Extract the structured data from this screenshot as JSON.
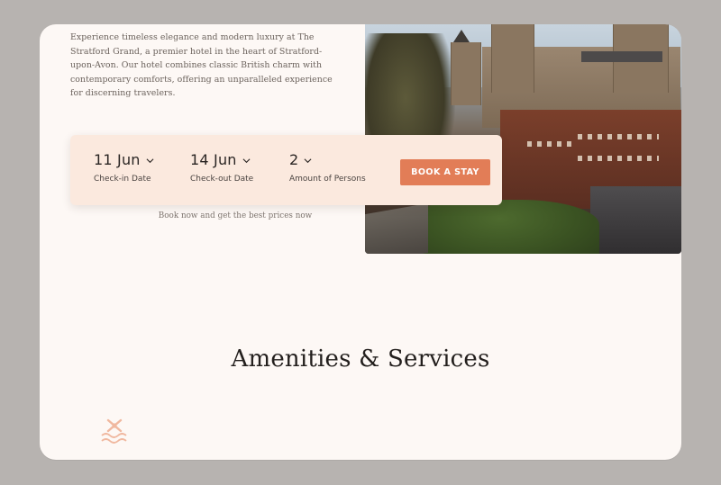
{
  "intro": {
    "text": "Experience timeless elegance and modern luxury at The Stratford Grand, a premier hotel in the heart of Stratford-upon-Avon. Our hotel combines classic British charm with contemporary comforts, offering an unparalleled experience for discerning travelers."
  },
  "booking": {
    "checkin": {
      "value": "11 Jun",
      "label": "Check-in Date"
    },
    "checkout": {
      "value": "14 Jun",
      "label": "Check-out Date"
    },
    "persons": {
      "value": "2",
      "label": "Amount of Persons"
    },
    "button_label": "BOOK A STAY",
    "note": "Book now and get the best prices now"
  },
  "amenities": {
    "title": "Amenities & Services",
    "first_icon": "swimming-pool-icon"
  },
  "colors": {
    "background": "#fdf8f5",
    "booking_bar": "#fbe9de",
    "accent": "#e27d57",
    "text_dark": "#231f1d"
  },
  "icons": {
    "dropdown": "chevron-down-icon"
  }
}
